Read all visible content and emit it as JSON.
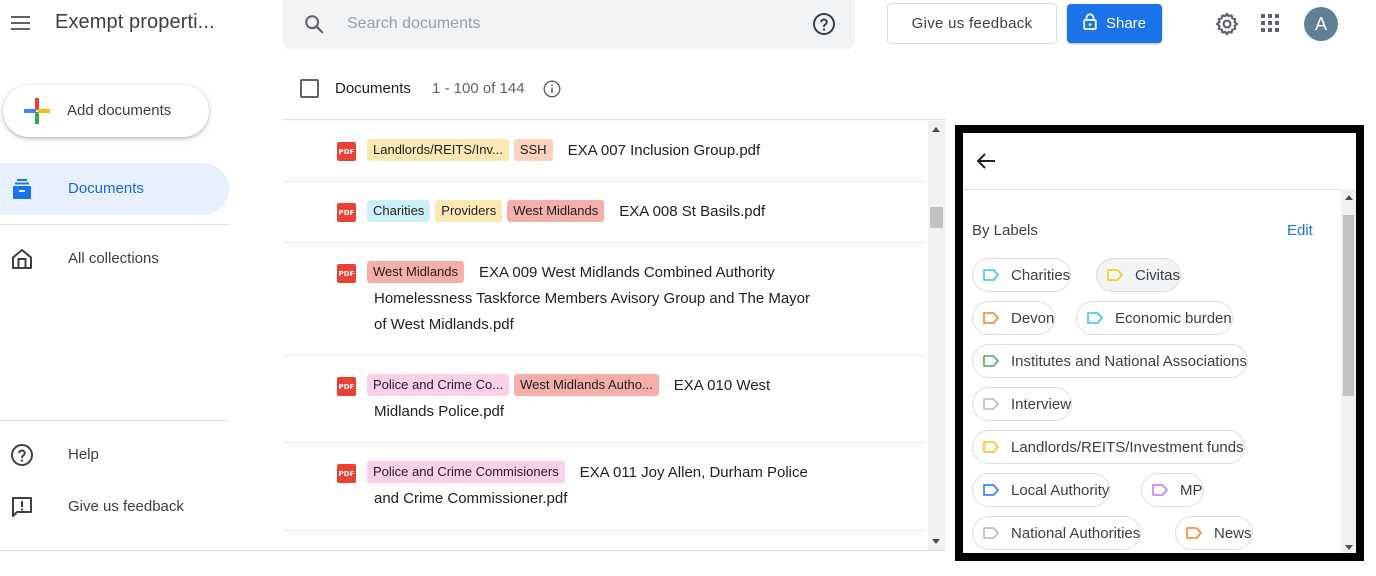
{
  "app": {
    "title": "Exempt properti..."
  },
  "search": {
    "placeholder": "Search documents"
  },
  "header": {
    "feedback_label": "Give us feedback",
    "share_label": "Share",
    "avatar_initial": "A"
  },
  "sidebar": {
    "add_documents_label": "Add documents",
    "items": [
      {
        "label": "Documents",
        "icon": "documents-icon",
        "selected": true
      },
      {
        "label": "All collections",
        "icon": "collections-home-icon",
        "selected": false
      }
    ],
    "bottom": [
      {
        "label": "Help",
        "icon": "help-icon"
      },
      {
        "label": "Give us feedback",
        "icon": "feedback-icon"
      }
    ]
  },
  "documents": {
    "heading": "Documents",
    "count_text": "1 - 100 of 144",
    "rows": [
      {
        "labels": [
          {
            "text": "Landlords/REITS/Inv...",
            "color": "#fce8b2"
          },
          {
            "text": "SSH",
            "color": "#fad2be"
          }
        ],
        "title_line1": "EXA 007 Inclusion Group.pdf",
        "title_rest": []
      },
      {
        "labels": [
          {
            "text": "Charities",
            "color": "#cbf0f8"
          },
          {
            "text": "Providers",
            "color": "#fce8b2"
          },
          {
            "text": "West Midlands",
            "color": "#f6aea9"
          }
        ],
        "title_line1": "EXA 008 St Basils.pdf",
        "title_rest": []
      },
      {
        "labels": [
          {
            "text": "West Midlands",
            "color": "#f6aea9"
          }
        ],
        "title_line1": "EXA 009 West Midlands Combined Authority",
        "title_rest": [
          "Homelessness Taskforce Members Avisory Group and The Mayor",
          "of West Midlands.pdf"
        ]
      },
      {
        "labels": [
          {
            "text": "Police and Crime Co...",
            "color": "#fdcfe8"
          },
          {
            "text": "West Midlands Autho...",
            "color": "#f6aea9"
          }
        ],
        "title_line1": "EXA 010 West",
        "title_rest": [
          "Midlands Police.pdf"
        ]
      },
      {
        "labels": [
          {
            "text": "Police and Crime Commisioners",
            "color": "#fdcfe8"
          }
        ],
        "title_line1": "EXA 011 Joy Allen, Durham Police",
        "title_rest": [
          "and Crime Commissioner.pdf"
        ]
      }
    ],
    "pdf_badge": "PDF"
  },
  "labels_panel": {
    "heading": "By Labels",
    "edit_label": "Edit",
    "chips": [
      {
        "text": "Charities",
        "color": "#4ecde6",
        "selected": false
      },
      {
        "text": "Civitas",
        "color": "#fcc934",
        "selected": true
      },
      {
        "text": "Devon",
        "color": "#fa903e",
        "selected": false
      },
      {
        "text": "Economic burden",
        "color": "#4ecde6",
        "selected": false
      },
      {
        "text": "Institutes and National Associations",
        "color": "#5bb974",
        "selected": false
      },
      {
        "text": "Interview",
        "color": "#bdc1c6",
        "selected": false
      },
      {
        "text": "Landlords/REITS/Investment funds",
        "color": "#fcc934",
        "selected": false
      },
      {
        "text": "Local Authority",
        "color": "#4285f4",
        "selected": false
      },
      {
        "text": "MP",
        "color": "#c58af9",
        "selected": false
      },
      {
        "text": "National Authorities",
        "color": "#bdc1c6",
        "selected": false
      },
      {
        "text": "News",
        "color": "#fa903e",
        "selected": false
      }
    ]
  },
  "colors": {
    "accent": "#1a73e8",
    "nav_selected_bg": "#e8f0fe"
  }
}
